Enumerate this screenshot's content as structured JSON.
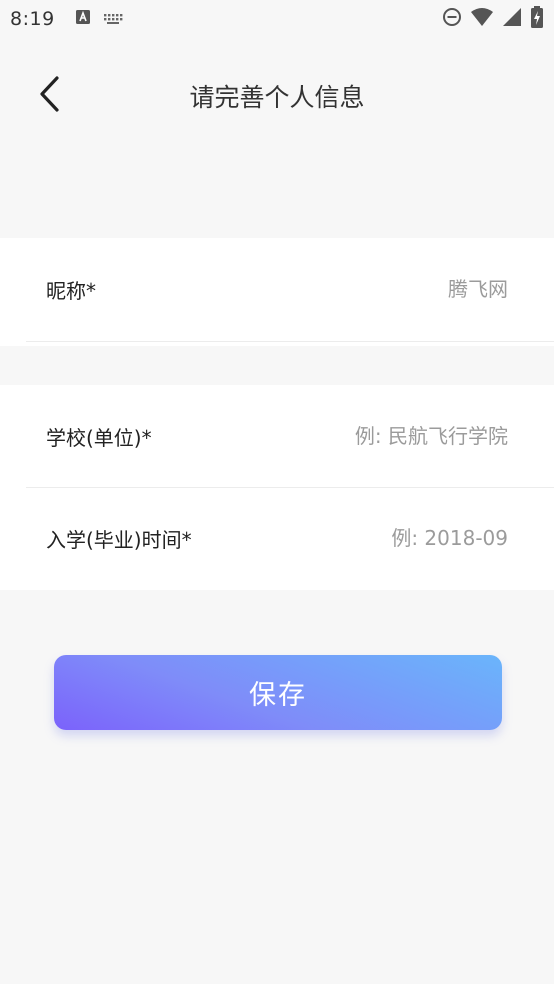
{
  "status_bar": {
    "time": "8:19",
    "icons": [
      "text-input-icon",
      "keyboard-icon",
      "do-not-disturb-icon",
      "wifi-icon",
      "cellular-signal-icon",
      "battery-charging-icon"
    ]
  },
  "header": {
    "back_icon": "chevron-left-icon",
    "title": "请完善个人信息"
  },
  "form": {
    "nickname": {
      "label": "昵称*",
      "placeholder": "腾飞网"
    },
    "school": {
      "label": "学校(单位)*",
      "placeholder": "例: 民航飞行学院"
    },
    "enroll_time": {
      "label": "入学(毕业)时间*",
      "placeholder": "例: 2018-09"
    }
  },
  "save_button": {
    "label": "保存"
  },
  "colors": {
    "background": "#f7f7f7",
    "card": "#ffffff",
    "placeholder": "#9b9b9b",
    "button_gradient_start": "#6ab5fb",
    "button_gradient_end": "#7b62fb"
  }
}
